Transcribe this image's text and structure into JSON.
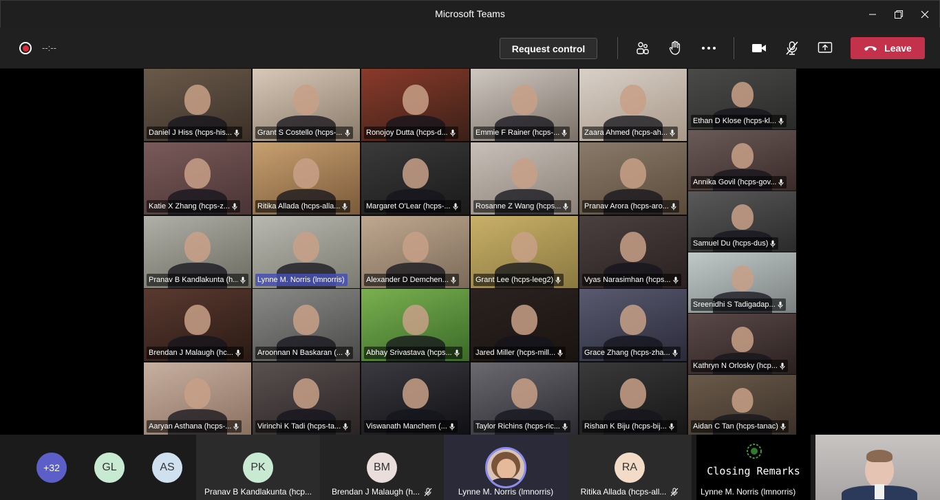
{
  "window": {
    "title": "Microsoft Teams"
  },
  "toolbar": {
    "timer": "--:--",
    "request_control_label": "Request control",
    "leave_label": "Leave",
    "icons": [
      "participants-icon",
      "raise-hand-icon",
      "more-options-icon",
      "camera-icon",
      "mic-off-icon",
      "share-screen-icon"
    ]
  },
  "grid": {
    "tiles": [
      {
        "name": "Daniel J Hiss (hcps-his..."
      },
      {
        "name": "Grant S Costello (hcps-..."
      },
      {
        "name": "Ronojoy Dutta (hcps-d..."
      },
      {
        "name": "Emmie F Rainer (hcps-..."
      },
      {
        "name": "Zaara Ahmed (hcps-ah..."
      },
      {
        "name": "Ethan D Klose (hcps-kl..."
      },
      {
        "name": "Katie X Zhang (hcps-z..."
      },
      {
        "name": "Ritika Allada (hcps-alla..."
      },
      {
        "name": "Margaret O'Lear (hcps-..."
      },
      {
        "name": "Rosanne Z Wang (hcps..."
      },
      {
        "name": "Pranav Arora (hcps-aro..."
      },
      {
        "name": "Annika Govil (hcps-gov..."
      },
      {
        "name": "Samuel Du (hcps-dus)"
      },
      {
        "name": "Pranav B Kandlakunta (h..."
      },
      {
        "name": "Lynne M. Norris (lmnorris)"
      },
      {
        "name": "Alexander D Demchen..."
      },
      {
        "name": "Grant Lee (hcps-leeg2)"
      },
      {
        "name": "Vyas Narasimhan (hcps..."
      },
      {
        "name": "Sreenidhi S Tadigadap..."
      },
      {
        "name": "Brendan J Malaugh (hc..."
      },
      {
        "name": "Aroonnan N Baskaran (..."
      },
      {
        "name": "Abhay Srivastava (hcps..."
      },
      {
        "name": "Jared Miller (hcps-mill..."
      },
      {
        "name": "Grace Zhang (hcps-zha..."
      },
      {
        "name": "Kathryn N Orlosky (hcp..."
      },
      {
        "name": "Aaryan Asthana (hcps-..."
      },
      {
        "name": "Virinchi K Tadi (hcps-ta..."
      },
      {
        "name": "Viswanath Manchem (..."
      },
      {
        "name": "Taylor Richins (hcps-ric..."
      },
      {
        "name": "Rishan K Biju (hcps-bij..."
      },
      {
        "name": "Aidan C Tan (hcps-tanac)"
      }
    ]
  },
  "bottom": {
    "overflow_count": "+32",
    "initials": [
      "GL",
      "AS"
    ],
    "participants": [
      {
        "initials": "PK",
        "name": "Pranav B Kandlakunta (hcp..."
      },
      {
        "initials": "BM",
        "name": "Brendan J Malaugh (h..."
      },
      {
        "initials": "",
        "name": "Lynne M. Norris (lmnorris)"
      },
      {
        "initials": "RA",
        "name": "Ritika Allada (hcps-all..."
      }
    ],
    "shared": {
      "content": "Closing Remarks",
      "presenter": "Lynne M. Norris (lmnorris)"
    }
  }
}
